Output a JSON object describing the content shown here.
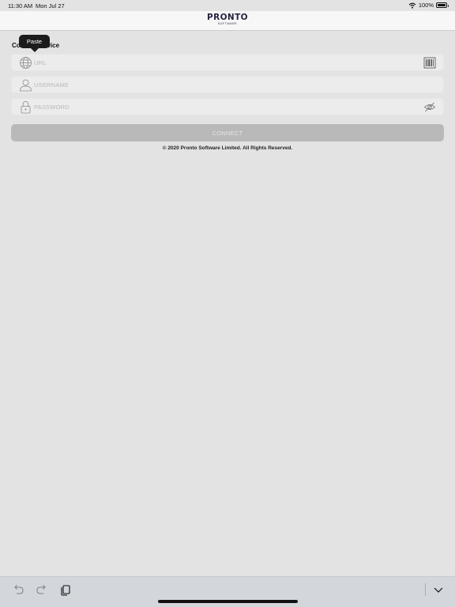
{
  "status_bar": {
    "time": "11:30 AM",
    "date": "Mon Jul 27",
    "battery": "100%"
  },
  "header": {
    "logo_main": "PRONTO",
    "logo_sub": "SOFTWARE"
  },
  "tooltip": {
    "label": "Paste"
  },
  "section": {
    "title": "Connect Device"
  },
  "form": {
    "url_placeholder": "URL",
    "username_placeholder": "USERNAME",
    "password_placeholder": "PASSWORD",
    "connect_label": "CONNECT"
  },
  "footer": {
    "copyright": "© 2020 Pronto Software Limited. All Rights Reserved."
  },
  "icons": {
    "url": "globe-icon",
    "url_action": "barcode-icon",
    "username": "user-icon",
    "password": "lock-icon",
    "password_action": "eye-icon",
    "undo": "undo-icon",
    "redo": "redo-icon",
    "paste": "paste-icon",
    "dismiss": "chevron-down-icon"
  }
}
